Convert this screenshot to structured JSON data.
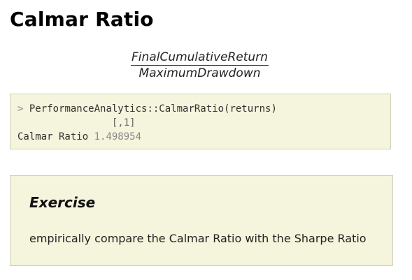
{
  "page": {
    "title": "Calmar Ratio"
  },
  "formula": {
    "numerator": "FinalCumulativeReturn",
    "denominator": "MaximumDrawdown"
  },
  "code": {
    "prompt": ">",
    "command": "PerformanceAnalytics::CalmarRatio(returns)",
    "column_header": "[,1]",
    "row_label": "Calmar Ratio",
    "row_value": "1.498954"
  },
  "exercise": {
    "title": "Exercise",
    "text": "empirically compare the Calmar Ratio with the Sharpe Ratio"
  }
}
